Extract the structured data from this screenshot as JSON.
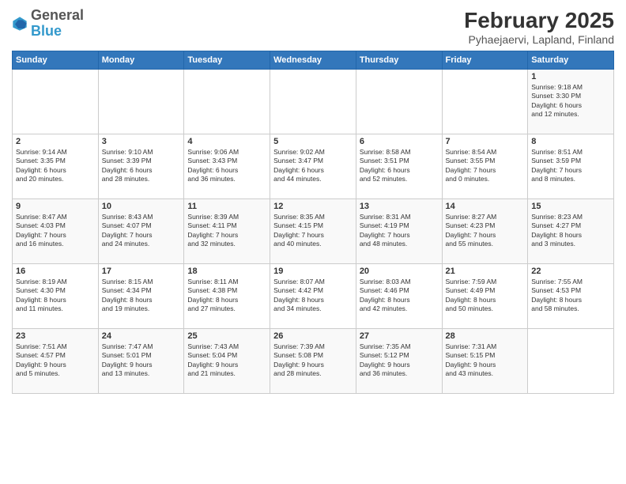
{
  "header": {
    "logo_general": "General",
    "logo_blue": "Blue",
    "main_title": "February 2025",
    "subtitle": "Pyhaejaervi, Lapland, Finland"
  },
  "weekdays": [
    "Sunday",
    "Monday",
    "Tuesday",
    "Wednesday",
    "Thursday",
    "Friday",
    "Saturday"
  ],
  "weeks": [
    [
      {
        "day": "",
        "info": ""
      },
      {
        "day": "",
        "info": ""
      },
      {
        "day": "",
        "info": ""
      },
      {
        "day": "",
        "info": ""
      },
      {
        "day": "",
        "info": ""
      },
      {
        "day": "",
        "info": ""
      },
      {
        "day": "1",
        "info": "Sunrise: 9:18 AM\nSunset: 3:30 PM\nDaylight: 6 hours\nand 12 minutes."
      }
    ],
    [
      {
        "day": "2",
        "info": "Sunrise: 9:14 AM\nSunset: 3:35 PM\nDaylight: 6 hours\nand 20 minutes."
      },
      {
        "day": "3",
        "info": "Sunrise: 9:10 AM\nSunset: 3:39 PM\nDaylight: 6 hours\nand 28 minutes."
      },
      {
        "day": "4",
        "info": "Sunrise: 9:06 AM\nSunset: 3:43 PM\nDaylight: 6 hours\nand 36 minutes."
      },
      {
        "day": "5",
        "info": "Sunrise: 9:02 AM\nSunset: 3:47 PM\nDaylight: 6 hours\nand 44 minutes."
      },
      {
        "day": "6",
        "info": "Sunrise: 8:58 AM\nSunset: 3:51 PM\nDaylight: 6 hours\nand 52 minutes."
      },
      {
        "day": "7",
        "info": "Sunrise: 8:54 AM\nSunset: 3:55 PM\nDaylight: 7 hours\nand 0 minutes."
      },
      {
        "day": "8",
        "info": "Sunrise: 8:51 AM\nSunset: 3:59 PM\nDaylight: 7 hours\nand 8 minutes."
      }
    ],
    [
      {
        "day": "9",
        "info": "Sunrise: 8:47 AM\nSunset: 4:03 PM\nDaylight: 7 hours\nand 16 minutes."
      },
      {
        "day": "10",
        "info": "Sunrise: 8:43 AM\nSunset: 4:07 PM\nDaylight: 7 hours\nand 24 minutes."
      },
      {
        "day": "11",
        "info": "Sunrise: 8:39 AM\nSunset: 4:11 PM\nDaylight: 7 hours\nand 32 minutes."
      },
      {
        "day": "12",
        "info": "Sunrise: 8:35 AM\nSunset: 4:15 PM\nDaylight: 7 hours\nand 40 minutes."
      },
      {
        "day": "13",
        "info": "Sunrise: 8:31 AM\nSunset: 4:19 PM\nDaylight: 7 hours\nand 48 minutes."
      },
      {
        "day": "14",
        "info": "Sunrise: 8:27 AM\nSunset: 4:23 PM\nDaylight: 7 hours\nand 55 minutes."
      },
      {
        "day": "15",
        "info": "Sunrise: 8:23 AM\nSunset: 4:27 PM\nDaylight: 8 hours\nand 3 minutes."
      }
    ],
    [
      {
        "day": "16",
        "info": "Sunrise: 8:19 AM\nSunset: 4:30 PM\nDaylight: 8 hours\nand 11 minutes."
      },
      {
        "day": "17",
        "info": "Sunrise: 8:15 AM\nSunset: 4:34 PM\nDaylight: 8 hours\nand 19 minutes."
      },
      {
        "day": "18",
        "info": "Sunrise: 8:11 AM\nSunset: 4:38 PM\nDaylight: 8 hours\nand 27 minutes."
      },
      {
        "day": "19",
        "info": "Sunrise: 8:07 AM\nSunset: 4:42 PM\nDaylight: 8 hours\nand 34 minutes."
      },
      {
        "day": "20",
        "info": "Sunrise: 8:03 AM\nSunset: 4:46 PM\nDaylight: 8 hours\nand 42 minutes."
      },
      {
        "day": "21",
        "info": "Sunrise: 7:59 AM\nSunset: 4:49 PM\nDaylight: 8 hours\nand 50 minutes."
      },
      {
        "day": "22",
        "info": "Sunrise: 7:55 AM\nSunset: 4:53 PM\nDaylight: 8 hours\nand 58 minutes."
      }
    ],
    [
      {
        "day": "23",
        "info": "Sunrise: 7:51 AM\nSunset: 4:57 PM\nDaylight: 9 hours\nand 5 minutes."
      },
      {
        "day": "24",
        "info": "Sunrise: 7:47 AM\nSunset: 5:01 PM\nDaylight: 9 hours\nand 13 minutes."
      },
      {
        "day": "25",
        "info": "Sunrise: 7:43 AM\nSunset: 5:04 PM\nDaylight: 9 hours\nand 21 minutes."
      },
      {
        "day": "26",
        "info": "Sunrise: 7:39 AM\nSunset: 5:08 PM\nDaylight: 9 hours\nand 28 minutes."
      },
      {
        "day": "27",
        "info": "Sunrise: 7:35 AM\nSunset: 5:12 PM\nDaylight: 9 hours\nand 36 minutes."
      },
      {
        "day": "28",
        "info": "Sunrise: 7:31 AM\nSunset: 5:15 PM\nDaylight: 9 hours\nand 43 minutes."
      },
      {
        "day": "",
        "info": ""
      }
    ]
  ]
}
